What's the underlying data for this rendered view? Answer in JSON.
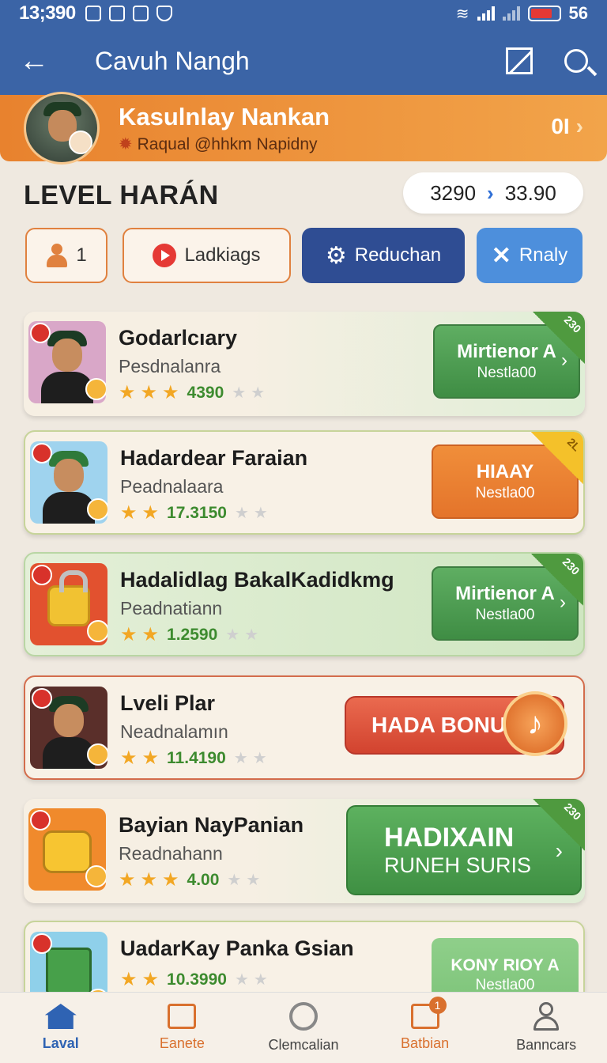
{
  "status_bar": {
    "time": "13;390",
    "battery": "56"
  },
  "app_bar": {
    "title": "Cavuh Nangh"
  },
  "profile": {
    "name": "Kasulnlay Nankan",
    "subtitle": "Raqual @hhkm Napidny",
    "count": "0I"
  },
  "level": {
    "title": "LEVEL HARÁN",
    "range_from": "3290",
    "range_to": "33.90"
  },
  "filters": {
    "player_count": "1",
    "tab_1": "Ladkiags",
    "tab_2": "Reduchan",
    "tab_3": "Rnaly"
  },
  "items": [
    {
      "title": "Godarlcıary",
      "subtitle": "Pesdnalanra",
      "rating": "4390",
      "cta_line1": "Mirtienor A",
      "cta_line2": "Nestla00",
      "ribbon": "230"
    },
    {
      "title": "Hadardear Faraian",
      "subtitle": "Peadnalaara",
      "rating": "17.3150",
      "cta_line1": "HIAAY",
      "cta_line2": "Nestla00",
      "ribbon": "2L"
    },
    {
      "title": "Hadalidlag BakalKadidkmg",
      "subtitle": "Peadnatiann",
      "rating": "1.2590",
      "cta_line1": "Mirtienor A",
      "cta_line2": "Nestla00",
      "ribbon": "230"
    },
    {
      "title": "Lveli Plar",
      "subtitle": "Neadnalamın",
      "rating": "11.4190",
      "cta_line1": "HADA BONUX"
    },
    {
      "title": "Bayian NayPanian",
      "subtitle": "Readnahann",
      "rating": "4.00",
      "cta_line1": "HADIXAIN",
      "cta_line2": "RUNEH SURIS",
      "ribbon": "230"
    },
    {
      "title": "UadarKay Panka Gsian",
      "rating": "10.3990",
      "cta_line1": "KONY RIOY A",
      "cta_line2": "Nestla00"
    }
  ],
  "bottom_nav": [
    {
      "label": "Laval"
    },
    {
      "label": "Eanete"
    },
    {
      "label": "Clemcalian"
    },
    {
      "label": "Batbian",
      "badge": "1"
    },
    {
      "label": "Banncars"
    }
  ],
  "colors": {
    "primary": "#3b64a6",
    "accent": "#e8822e",
    "success": "#4c9f50",
    "danger": "#d9432f"
  }
}
